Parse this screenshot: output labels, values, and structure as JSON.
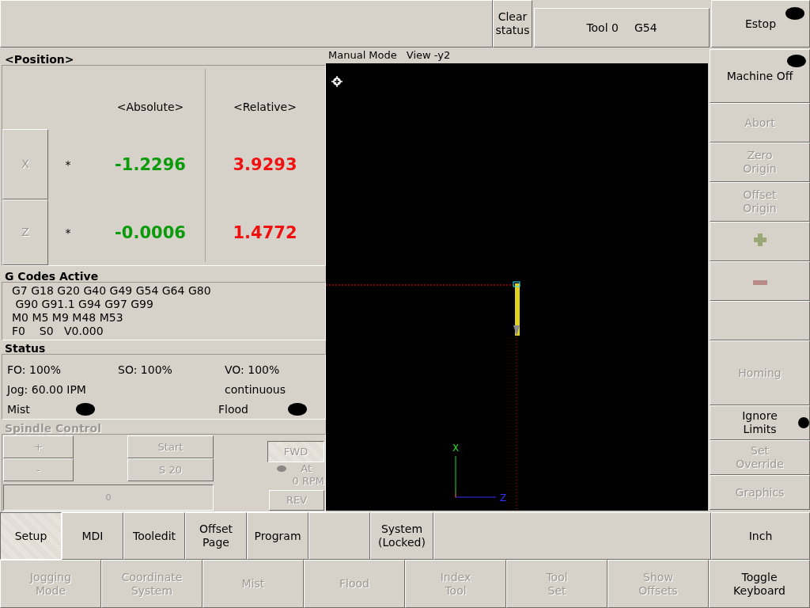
{
  "top_bar": {
    "clear_status": "Clear\nstatus",
    "tool": "Tool 0",
    "coordinate_system": "G54",
    "estop": {
      "label": "Estop",
      "on": false
    }
  },
  "position": {
    "title": "<Position>",
    "absolute_header": "<Absolute>",
    "relative_header": "<Relative>",
    "axes": [
      {
        "label": "X",
        "marker": "*",
        "absolute": "-1.2296",
        "relative": "3.9293"
      },
      {
        "label": "Z",
        "marker": "*",
        "absolute": "-0.0006",
        "relative": "1.4772"
      }
    ]
  },
  "gcodes": {
    "title": "G Codes Active",
    "lines": [
      "G7 G18 G20 G40 G49 G54 G64 G80",
      " G90 G91.1 G94 G97 G99",
      "M0 M5 M9 M48 M53",
      "F0    S0   V0.000"
    ]
  },
  "status": {
    "title": "Status",
    "feed_override": "FO: 100%",
    "spindle_override": "SO: 100%",
    "velocity_override": "VO: 100%",
    "jog": "Jog: 60.00 IPM",
    "jog_mode": "continuous",
    "mist": {
      "label": "Mist",
      "on": false
    },
    "flood": {
      "label": "Flood",
      "on": false
    }
  },
  "spindle": {
    "title": "Spindle Control",
    "disabled": true,
    "increase": "+",
    "decrease": "-",
    "start": "Start",
    "speed": "S 20",
    "bar": {
      "text": "0"
    },
    "forward": {
      "label": "FWD",
      "selected": true
    },
    "at_speed": {
      "on": false,
      "label": "At",
      "rpm": "0 RPM"
    },
    "reverse": {
      "label": "REV",
      "selected": false
    }
  },
  "view": {
    "mode": "Manual Mode",
    "view": "View -y2",
    "axes": [
      {
        "label": "X"
      },
      {
        "label": "Z"
      }
    ]
  },
  "side_buttons": [
    {
      "kind": "indicator",
      "label": "Machine Off",
      "on": false,
      "disabled": false
    },
    {
      "kind": "plain",
      "label": "Abort",
      "disabled": true
    },
    {
      "kind": "plain",
      "label": "Zero\nOrigin",
      "disabled": true
    },
    {
      "kind": "plain",
      "label": "Offset\nOrigin",
      "disabled": true
    },
    {
      "kind": "increase"
    },
    {
      "kind": "decrease"
    },
    {
      "kind": "blank"
    },
    {
      "kind": "plain",
      "label": "Homing",
      "disabled": true
    },
    {
      "kind": "indicator",
      "label": "Ignore\nLimits",
      "on": false,
      "disabled": false
    },
    {
      "kind": "plain",
      "label": "Set\nOverride",
      "disabled": true
    },
    {
      "kind": "plain",
      "label": "Graphics",
      "disabled": true
    }
  ],
  "tabs": [
    {
      "kind": "tab",
      "label": "Setup",
      "selected": true
    },
    {
      "kind": "tab",
      "label": "MDI",
      "selected": false
    },
    {
      "kind": "tab",
      "label": "Tooledit",
      "selected": false
    },
    {
      "kind": "tab",
      "label": "Offset\nPage",
      "selected": false
    },
    {
      "kind": "tab",
      "label": "Program",
      "selected": false
    },
    {
      "kind": "blank",
      "selected": false
    },
    {
      "kind": "tab",
      "label": "System\n(Locked)",
      "selected": false
    }
  ],
  "units_button": "Inch",
  "actions": [
    {
      "label": "Jogging\nMode",
      "disabled": true
    },
    {
      "label": "Coordinate\nSystem",
      "disabled": true
    },
    {
      "label": "Mist",
      "disabled": true
    },
    {
      "label": "Flood",
      "disabled": true
    },
    {
      "label": "Index\nTool",
      "disabled": true
    },
    {
      "label": "Tool\nSet",
      "disabled": true
    },
    {
      "label": "Show\nOffsets",
      "disabled": true
    },
    {
      "label": "Toggle\nKeyboard",
      "disabled": false
    }
  ]
}
